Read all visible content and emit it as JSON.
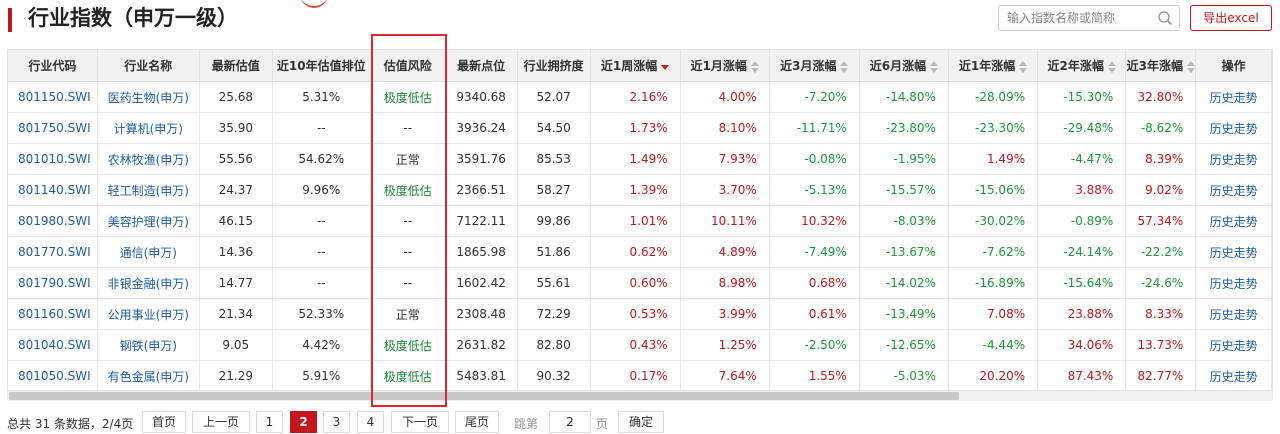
{
  "header": {
    "title": "行业指数（申万一级）",
    "search_placeholder": "输入指数名称或简称",
    "export_label": "导出excel"
  },
  "colors": {
    "accent": "#c4161c",
    "up": "#c4161c",
    "down": "#1b9a3a",
    "link": "#1e5fa8",
    "risk_low": "#1b8a3a"
  },
  "table": {
    "columns": [
      "行业代码",
      "行业名称",
      "最新估值",
      "近10年估值排位",
      "估值风险",
      "最新点位",
      "行业拥挤度",
      "近1周涨幅",
      "近1月涨幅",
      "近3月涨幅",
      "近6月涨幅",
      "近1年涨幅",
      "近2年涨幅",
      "近3年涨幅",
      "操作"
    ],
    "active_sort": "近1周涨幅",
    "rows": [
      {
        "code": "801150.SWI",
        "name": "医药生物(申万)",
        "pe": "25.68",
        "rank": "5.31%",
        "risk": "极度低估",
        "point": "9340.68",
        "crowd": "52.07",
        "w1": "2.16%",
        "m1": "4.00%",
        "m3": "-7.20%",
        "m6": "-14.80%",
        "y1": "-28.09%",
        "y2": "-15.30%",
        "y3": "32.80%",
        "op": "历史走势"
      },
      {
        "code": "801750.SWI",
        "name": "计算机(申万)",
        "pe": "35.90",
        "rank": "--",
        "risk": "--",
        "point": "3936.24",
        "crowd": "54.50",
        "w1": "1.73%",
        "m1": "8.10%",
        "m3": "-11.71%",
        "m6": "-23.80%",
        "y1": "-23.30%",
        "y2": "-29.48%",
        "y3": "-8.62%",
        "op": "历史走势"
      },
      {
        "code": "801010.SWI",
        "name": "农林牧渔(申万)",
        "pe": "55.56",
        "rank": "54.62%",
        "risk": "正常",
        "point": "3591.76",
        "crowd": "85.53",
        "w1": "1.49%",
        "m1": "7.93%",
        "m3": "-0.08%",
        "m6": "-1.95%",
        "y1": "1.49%",
        "y2": "-4.47%",
        "y3": "8.39%",
        "op": "历史走势"
      },
      {
        "code": "801140.SWI",
        "name": "轻工制造(申万)",
        "pe": "24.37",
        "rank": "9.96%",
        "risk": "极度低估",
        "point": "2366.51",
        "crowd": "58.27",
        "w1": "1.39%",
        "m1": "3.70%",
        "m3": "-5.13%",
        "m6": "-15.57%",
        "y1": "-15.06%",
        "y2": "3.88%",
        "y3": "9.02%",
        "op": "历史走势"
      },
      {
        "code": "801980.SWI",
        "name": "美容护理(申万)",
        "pe": "46.15",
        "rank": "--",
        "risk": "--",
        "point": "7122.11",
        "crowd": "99.86",
        "w1": "1.01%",
        "m1": "10.11%",
        "m3": "10.32%",
        "m6": "-8.03%",
        "y1": "-30.02%",
        "y2": "-0.89%",
        "y3": "57.34%",
        "op": "历史走势"
      },
      {
        "code": "801770.SWI",
        "name": "通信(申万)",
        "pe": "14.36",
        "rank": "--",
        "risk": "--",
        "point": "1865.98",
        "crowd": "51.86",
        "w1": "0.62%",
        "m1": "4.89%",
        "m3": "-7.49%",
        "m6": "-13.67%",
        "y1": "-7.62%",
        "y2": "-24.14%",
        "y3": "-22.2%",
        "op": "历史走势"
      },
      {
        "code": "801790.SWI",
        "name": "非银金融(申万)",
        "pe": "14.77",
        "rank": "--",
        "risk": "--",
        "point": "1602.42",
        "crowd": "55.61",
        "w1": "0.60%",
        "m1": "8.98%",
        "m3": "0.68%",
        "m6": "-14.02%",
        "y1": "-16.89%",
        "y2": "-15.64%",
        "y3": "-24.6%",
        "op": "历史走势"
      },
      {
        "code": "801160.SWI",
        "name": "公用事业(申万)",
        "pe": "21.34",
        "rank": "52.33%",
        "risk": "正常",
        "point": "2308.48",
        "crowd": "72.29",
        "w1": "0.53%",
        "m1": "3.99%",
        "m3": "0.61%",
        "m6": "-13.49%",
        "y1": "7.08%",
        "y2": "23.88%",
        "y3": "8.33%",
        "op": "历史走势"
      },
      {
        "code": "801040.SWI",
        "name": "钢铁(申万)",
        "pe": "9.05",
        "rank": "4.42%",
        "risk": "极度低估",
        "point": "2631.82",
        "crowd": "82.80",
        "w1": "0.43%",
        "m1": "1.25%",
        "m3": "-2.50%",
        "m6": "-12.65%",
        "y1": "-4.44%",
        "y2": "34.06%",
        "y3": "13.73%",
        "op": "历史走势"
      },
      {
        "code": "801050.SWI",
        "name": "有色金属(申万)",
        "pe": "21.29",
        "rank": "5.91%",
        "risk": "极度低估",
        "point": "5483.81",
        "crowd": "90.32",
        "w1": "0.17%",
        "m1": "7.64%",
        "m3": "1.55%",
        "m6": "-5.03%",
        "y1": "20.20%",
        "y2": "87.43%",
        "y3": "82.77%",
        "op": "历史走势"
      }
    ]
  },
  "pager": {
    "total_text": "总共 31 条数据，2/4页",
    "first": "首页",
    "prev": "上一页",
    "pages": [
      "1",
      "2",
      "3",
      "4"
    ],
    "current": "2",
    "next": "下一页",
    "last": "尾页",
    "jump_prefix": "跳第",
    "jump_value": "2",
    "jump_suffix": "页",
    "confirm": "确定"
  }
}
